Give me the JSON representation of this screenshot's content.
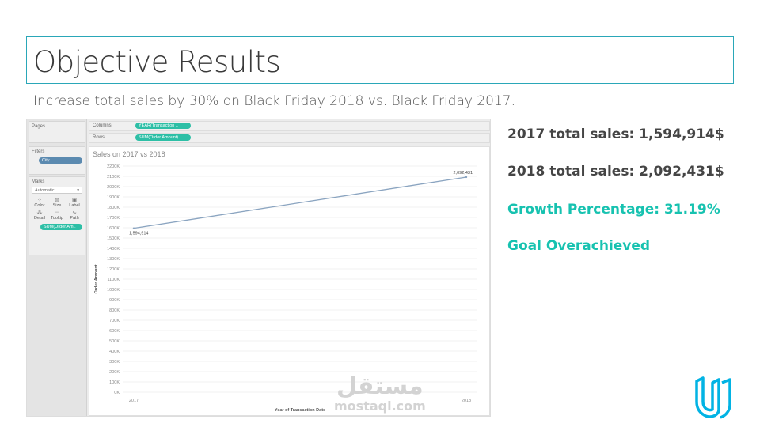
{
  "slide": {
    "title": "Objective Results",
    "subtitle": "Increase total sales by 30% on Black Friday 2018 vs. Black Friday 2017."
  },
  "tableau": {
    "pages_label": "Pages",
    "filters_label": "Filters",
    "filter_pill": "City",
    "marks_label": "Marks",
    "marks_type": "Automatic",
    "marks_buttons": [
      "Color",
      "Size",
      "Label",
      "Detail",
      "Tooltip",
      "Path"
    ],
    "marks_pill": "SUM(Order Am..",
    "columns_label": "Columns",
    "columns_pill": "YEAR(Transaction ..",
    "rows_label": "Rows",
    "rows_pill": "SUM(Order Amount)"
  },
  "chart_data": {
    "type": "line",
    "title": "Sales on 2017 vs 2018",
    "xlabel": "Year of Transaction Date",
    "ylabel": "Order Amount",
    "x": [
      "2017",
      "2018"
    ],
    "series": [
      {
        "values": [
          1594914,
          2092431
        ]
      }
    ],
    "data_labels": [
      "1,594,914",
      "2,092,431"
    ],
    "yticks": [
      "0K",
      "100K",
      "200K",
      "300K",
      "400K",
      "500K",
      "600K",
      "700K",
      "800K",
      "900K",
      "1000K",
      "1100K",
      "1200K",
      "1300K",
      "1400K",
      "1500K",
      "1600K",
      "1700K",
      "1800K",
      "1900K",
      "2000K",
      "2100K",
      "2200K"
    ],
    "ylim": [
      0,
      2200000
    ],
    "line_color": "#8aa4c0",
    "grid": true
  },
  "stats": {
    "sales_2017": "2017 total sales: 1,594,914$",
    "sales_2018": "2018 total sales: 2,092,431$",
    "growth": "Growth Percentage: 31.19%",
    "goal": "Goal Overachieved"
  },
  "watermark": {
    "arabic": "مستقل",
    "latin": "mostaql.com"
  },
  "colors": {
    "accent": "#17c2b0",
    "border": "#2aa7b8",
    "text_dark": "#454545"
  }
}
